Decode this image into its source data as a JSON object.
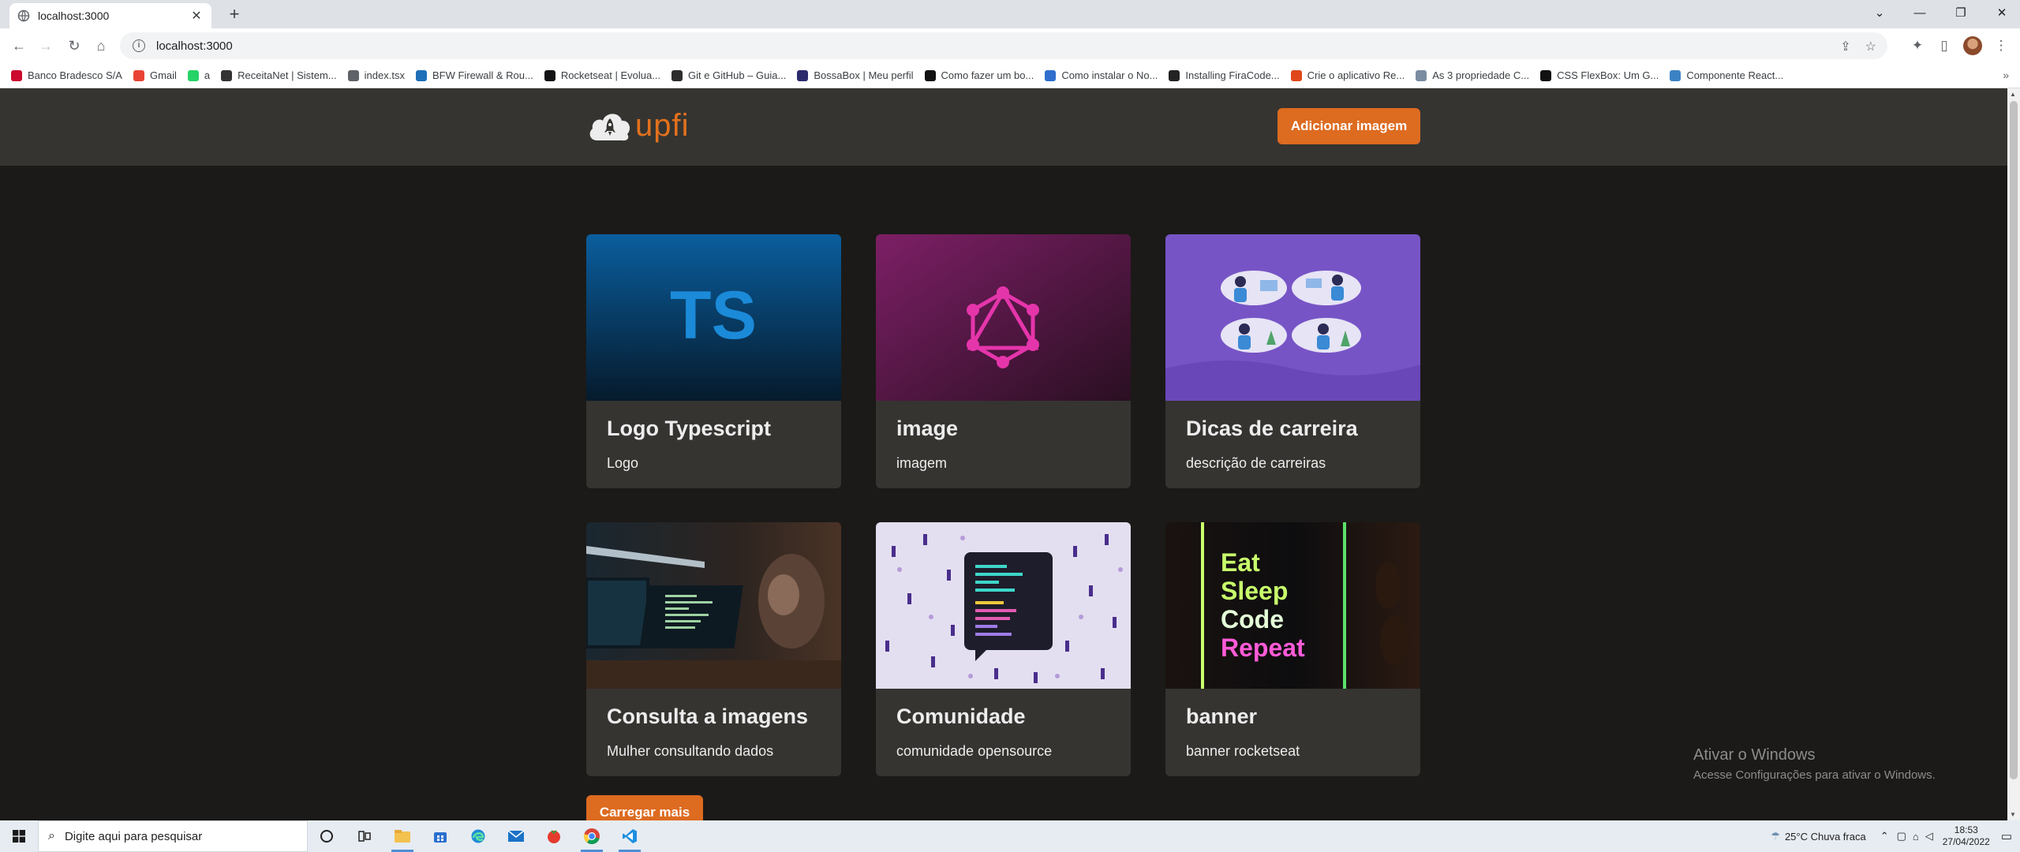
{
  "browser": {
    "tab_title": "localhost:3000",
    "url": "localhost:3000",
    "bookmarks": [
      {
        "label": "Banco Bradesco S/A",
        "color": "#cc092f"
      },
      {
        "label": "Gmail",
        "color": "#ea4335"
      },
      {
        "label": "a",
        "color": "#25d366"
      },
      {
        "label": "ReceitaNet | Sistem...",
        "color": "#333333"
      },
      {
        "label": "index.tsx",
        "color": "#5f6368"
      },
      {
        "label": "BFW Firewall & Rou...",
        "color": "#1e6fb8"
      },
      {
        "label": "Rocketseat | Evolua...",
        "color": "#121214"
      },
      {
        "label": "Git e GitHub – Guia...",
        "color": "#2d2d2d"
      },
      {
        "label": "BossaBox | Meu perfil",
        "color": "#2c2a6b"
      },
      {
        "label": "Como fazer um bo...",
        "color": "#111111"
      },
      {
        "label": "Como instalar o No...",
        "color": "#2f6ecf"
      },
      {
        "label": "Installing FiraCode...",
        "color": "#222222"
      },
      {
        "label": "Crie o aplicativo Re...",
        "color": "#e0481c"
      },
      {
        "label": "As 3 propriedade C...",
        "color": "#7a8ca0"
      },
      {
        "label": "CSS FlexBox: Um G...",
        "color": "#111111"
      },
      {
        "label": "Componente React...",
        "color": "#3b82c4"
      }
    ]
  },
  "app": {
    "logo_text": "upfi",
    "add_button": "Adicionar imagem",
    "load_more": "Carregar mais",
    "brand_color": "#dd6b20",
    "cards": [
      {
        "title": "Logo Typescript",
        "description": "Logo",
        "image": "typescript-logo",
        "image_text": "TS"
      },
      {
        "title": "image",
        "description": "imagem",
        "image": "graphql-logo"
      },
      {
        "title": "Dicas de carreira",
        "description": "descrição de carreiras",
        "image": "career-illustration"
      },
      {
        "title": "Consulta a imagens",
        "description": "Mulher consultando dados",
        "image": "woman-at-computer-photo"
      },
      {
        "title": "Comunidade",
        "description": "comunidade opensource",
        "image": "community-illustration"
      },
      {
        "title": "banner",
        "description": "banner rocketseat",
        "image": "eat-sleep-code-neon",
        "image_lines": [
          "Eat",
          "Sleep",
          "Code",
          "Repeat"
        ]
      }
    ]
  },
  "windows": {
    "watermark_title": "Ativar o Windows",
    "watermark_sub": "Acesse Configurações para ativar o Windows.",
    "search_placeholder": "Digite aqui para pesquisar",
    "weather": "25°C  Chuva fraca",
    "time": "18:53",
    "date": "27/04/2022"
  }
}
